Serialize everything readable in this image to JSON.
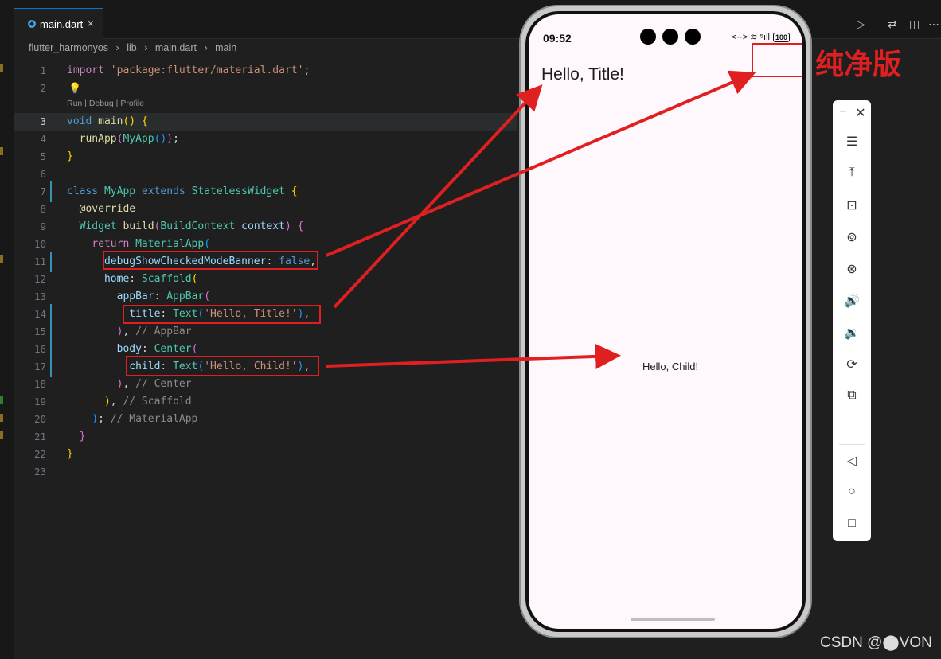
{
  "editor": {
    "tab_label": "main.dart",
    "tab_close": "×",
    "breadcrumb": [
      "flutter_harmonyos",
      "›",
      "lib",
      "›",
      "main.dart",
      "›",
      "main"
    ],
    "codelens": "Run | Debug | Profile",
    "top_icons": [
      "▷",
      "⇄",
      "◫",
      "⋯"
    ],
    "line_numbers": [
      "1",
      "2",
      "3",
      "4",
      "5",
      "6",
      "7",
      "8",
      "9",
      "10",
      "11",
      "12",
      "13",
      "14",
      "15",
      "16",
      "17",
      "18",
      "19",
      "20",
      "21",
      "22",
      "23"
    ]
  },
  "phone": {
    "status_time": "09:52",
    "status_icons": "<··> ≋ ⁵ıll",
    "battery": "100",
    "app_bar_title": "Hello, Title!",
    "body_text": "Hello, Child!"
  },
  "emulator_toolbar": {
    "minimize": "−",
    "close": "✕",
    "buttons": [
      "☰",
      "⤒",
      "⊡",
      "⊚",
      "⊛",
      "🔊",
      "🔉",
      "⟳",
      "⧉"
    ],
    "nav": [
      "◁",
      "○",
      "□"
    ]
  },
  "annotations": {
    "label": "纯净版",
    "watermark": "CSDN @⬤VON",
    "arrow_color": "#e02020"
  }
}
